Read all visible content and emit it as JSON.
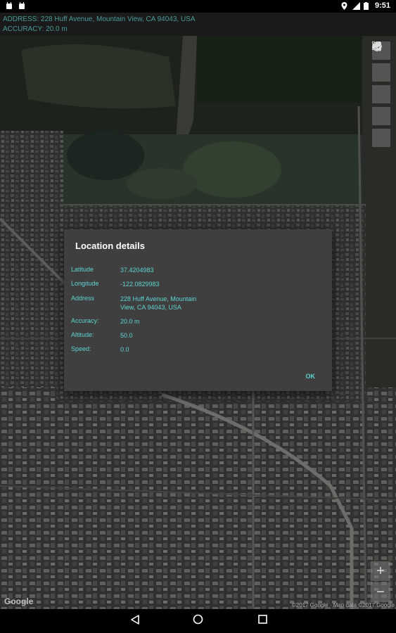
{
  "status_bar": {
    "time": "9:51",
    "icons": [
      "android-notification-icon",
      "android-notification-icon",
      "location-icon",
      "signal-icon",
      "battery-icon"
    ]
  },
  "info_bar": {
    "address": "ADDRESS: 228 Huff Avenue, Mountain View, CA 94043, USA",
    "accuracy": "ACCURACY: 20.0 m"
  },
  "map": {
    "provider_logo": "Google",
    "attribution": "©2017 Google · Map data ©2017 Google",
    "controls": [
      "my-location-icon",
      "layers-icon",
      "fullscreen-icon",
      "info-icon",
      "share-icon"
    ],
    "zoom_in": "+",
    "zoom_out": "−"
  },
  "dialog": {
    "title": "Location details",
    "rows": [
      {
        "label": "Latitude",
        "value": "37.4204983"
      },
      {
        "label": "Longitude",
        "value": "-122.0829983"
      },
      {
        "label": "Address",
        "value": "228 Huff Avenue, Mountain View, CA 94043, USA"
      },
      {
        "label": "Accuracy:",
        "value": "20.0 m"
      },
      {
        "label": "Altitude:",
        "value": "50.0"
      },
      {
        "label": "Speed:",
        "value": "0.0"
      }
    ],
    "ok_label": "OK"
  },
  "nav_bar": {
    "buttons": [
      "back-icon",
      "home-icon",
      "recents-icon"
    ]
  },
  "colors": {
    "accent": "#5fd3d3",
    "info_text": "#4a9a9a",
    "dialog_bg": "#3f3f3f"
  }
}
